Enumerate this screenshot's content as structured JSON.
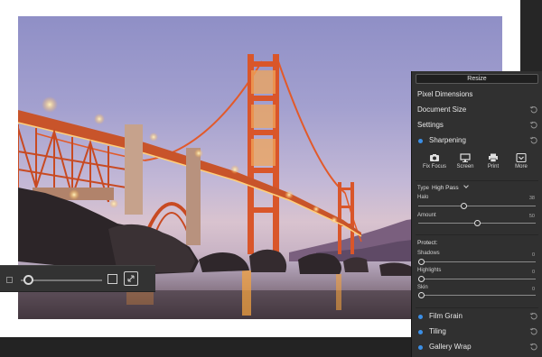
{
  "canvas": {
    "zoom": {
      "level": 0.05,
      "icons": [
        "small-square-icon",
        "large-square-icon",
        "fit-to-screen-icon"
      ]
    }
  },
  "panel": {
    "resize_button": "Resize",
    "sections": {
      "pixel_dimensions": "Pixel Dimensions",
      "document_size": "Document Size",
      "settings": "Settings",
      "sharpening": "Sharpening",
      "film_grain": "Film Grain",
      "tiling": "Tiling",
      "gallery_wrap": "Gallery Wrap"
    },
    "sharpening": {
      "presets": [
        {
          "label": "Fix Focus",
          "icon": "camera-icon"
        },
        {
          "label": "Screen",
          "icon": "monitor-icon"
        },
        {
          "label": "Print",
          "icon": "printer-icon"
        },
        {
          "label": "More",
          "icon": "more-chevron-icon"
        }
      ],
      "type_label": "Type",
      "type_value": "High Pass",
      "halo": {
        "label": "Halo",
        "value": "38",
        "level": 0.38
      },
      "amount": {
        "label": "Amount",
        "value": "50",
        "level": 0.5
      },
      "protect_label": "Protect:",
      "shadows": {
        "label": "Shadows",
        "value": "0",
        "level": 0.0
      },
      "highlights": {
        "label": "Highlights",
        "value": "0",
        "level": 0.0
      },
      "skin": {
        "label": "Skin",
        "value": "0",
        "level": 0.0
      }
    },
    "colors": {
      "accent_dot": "#3b8fe6",
      "panel_bg": "#303030"
    }
  }
}
